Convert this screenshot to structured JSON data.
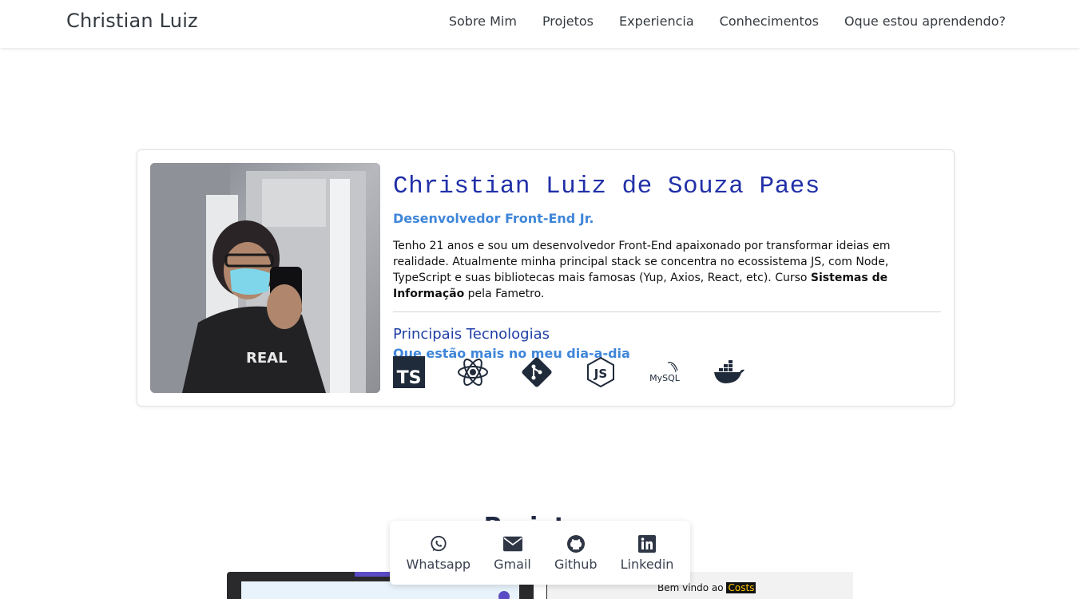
{
  "navbar": {
    "brand": "Christian Luiz",
    "links": [
      "Sobre Mim",
      "Projetos",
      "Experiencia",
      "Conhecimentos",
      "Oque estou aprendendo?"
    ]
  },
  "profile": {
    "name": "Christian Luiz de Souza Paes",
    "role": "Desenvolvedor Front-End Jr.",
    "bio_part1": "Tenho 21 anos e sou um desenvolvedor Front-End apaixonado por transformar ideias em realidade. Atualmente minha principal stack se concentra no ecossistema JS, com Node, TypeScript e suas bibliotecas mais famosas (Yup, Axios, React, etc). Curso ",
    "bio_bold": "Sistemas de Informação",
    "bio_part2": " pela Fametro.",
    "tech_title": "Principais Tecnologias",
    "tech_subtitle": "Que estão mais no meu dia-a-dia",
    "technologies": [
      {
        "name": "typescript",
        "icon": "typescript-icon",
        "label": "TS"
      },
      {
        "name": "react",
        "icon": "react-icon"
      },
      {
        "name": "git",
        "icon": "git-icon"
      },
      {
        "name": "nodejs",
        "icon": "nodejs-icon",
        "label": "JS"
      },
      {
        "name": "mysql",
        "icon": "mysql-icon",
        "label": "MySQL"
      },
      {
        "name": "docker",
        "icon": "docker-icon"
      }
    ]
  },
  "projects": {
    "title": "Projetos",
    "preview_welcome": "Bem vindo ao",
    "preview_highlight": "Costs"
  },
  "contact": {
    "items": [
      {
        "label": "Whatsapp",
        "icon": "whatsapp-icon"
      },
      {
        "label": "Gmail",
        "icon": "mail-icon"
      },
      {
        "label": "Github",
        "icon": "github-icon"
      },
      {
        "label": "Linkedin",
        "icon": "linkedin-icon"
      }
    ]
  },
  "colors": {
    "name": "#2130a8",
    "accent": "#3f86d9",
    "heading": "#1f3fa6"
  }
}
